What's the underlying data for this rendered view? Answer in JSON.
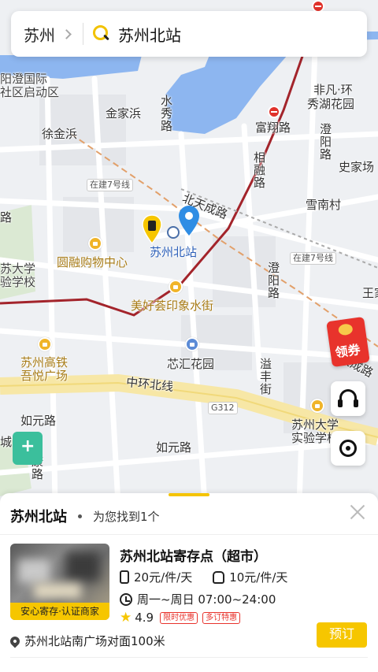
{
  "search": {
    "city": "苏州",
    "query": "苏州北站"
  },
  "map": {
    "labels": {
      "yangcheng": "阳澄国际",
      "yangcheng2": "社区启动区",
      "jinjiabang": "金家浜",
      "xujinbang": "徐金浜",
      "shuixiu": "水秀路",
      "fufan": "非凡·环",
      "fufan2": "秀湖花园",
      "fuxiang": "富翔路",
      "xiangrong": "相融路",
      "chengyang": "澄阳路",
      "shijiachang": "史家场",
      "xuenan": "雪南村",
      "beitiancheng": "北天成路",
      "dongda": "苏州北站",
      "suda": "苏大学",
      "suda2": "验学校",
      "yuanrong": "圆融购物中心",
      "meihao": "美好荟印象水街",
      "xinhui": "芯汇花园",
      "tiancheng": "天成路",
      "yifeng": "溢丰街",
      "gaotie": "苏州高铁",
      "gaotie2": "吾悦广场",
      "zhonghuan": "中环北线",
      "g312": "G312",
      "suzhoudaxue": "苏州大学",
      "suzhoudaxue2": "实验学校",
      "ruyuan1": "如元路",
      "ruyuan2": "如元路",
      "line7a": "在建7号线",
      "line7b": "在建7号线",
      "wang": "王家",
      "cheng": "城",
      "lu1": "路",
      "kang": "康路"
    }
  },
  "buttons": {
    "coupon": "领券"
  },
  "sheet": {
    "title": "苏州北站",
    "count": "为您找到1个",
    "item": {
      "badge": "安心寄存·认证商家",
      "name": "苏州北站寄存点（超市）",
      "price_luggage": "20元/件/天",
      "price_bag": "10元/件/天",
      "hours": "周一~周日 07:00~24:00",
      "rating": "4.9",
      "tags": [
        "限时优惠",
        "多订特惠"
      ],
      "address": "苏州北站南广场对面100米",
      "book": "预订"
    }
  }
}
